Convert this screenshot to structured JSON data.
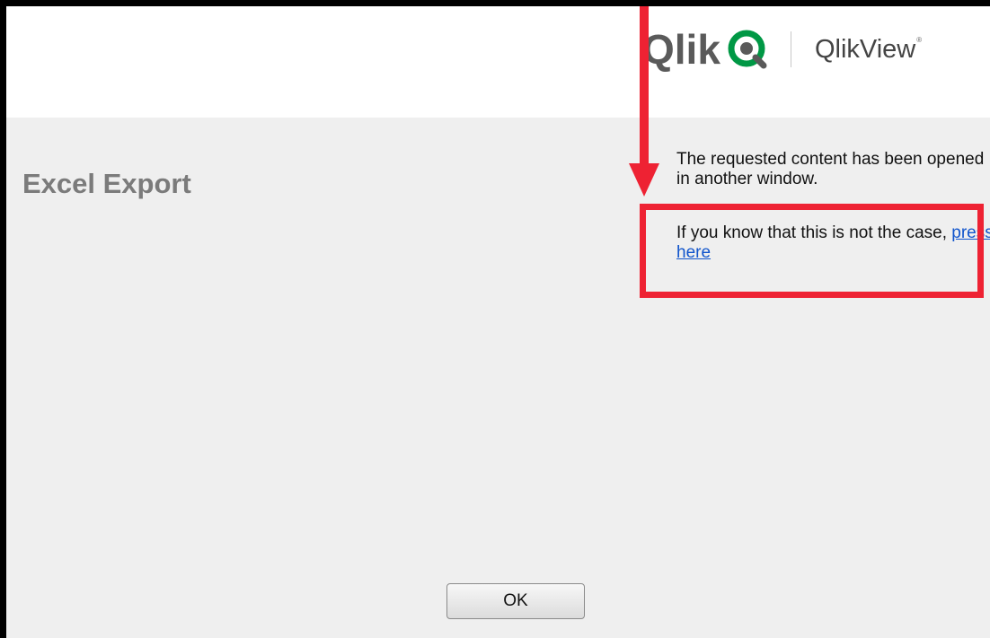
{
  "header": {
    "brand_logo_text": "Qlik",
    "product_name": "QlikView",
    "trademark": "®"
  },
  "dialog": {
    "title": "Excel Export",
    "message_line1": "The requested content has been opened in another window.",
    "message_line2_prefix": "If you know that this is not the case,",
    "link_text": "press here",
    "ok_label": "OK"
  },
  "annotation": {
    "color": "#ee2233"
  },
  "colors": {
    "header_bg": "#ffffff",
    "content_bg": "#efefef",
    "title": "#7b7b7b",
    "link": "#1155cc",
    "qlik_green": "#009845"
  }
}
